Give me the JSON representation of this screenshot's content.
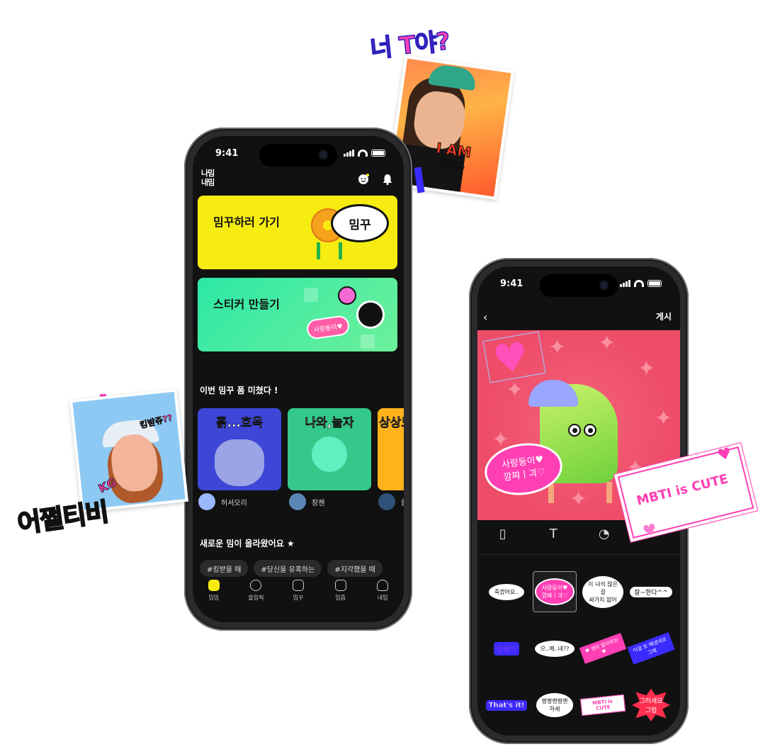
{
  "status_bar": {
    "time": "9:41"
  },
  "home": {
    "logo": "나밈\n내밈",
    "card_meme": {
      "title": "밈꾸하러 가기",
      "bubble": "밈꾸"
    },
    "card_sticker": {
      "title": "스티커 만들기",
      "pill": "사랑둥이♥"
    },
    "section_hot": "이번 밈꾸 폼 미쳤다 !",
    "thumbnails": [
      {
        "label": "흙...흐윽",
        "creator": "허서오리",
        "bg": "#3d46d6"
      },
      {
        "label": "나와,놀자",
        "creator": "장첸",
        "bg": "#34c98a"
      },
      {
        "label": "상상도",
        "creator": "들",
        "bg": "#ffb21c"
      }
    ],
    "section_new": "새로운 밈이 올라왔어요 ★",
    "chips": [
      "#킹받을 때",
      "#당신을 유혹하는",
      "#지각했을 때"
    ],
    "tabs": [
      "밈밈",
      "올밈픽",
      "밈꾸",
      "밈즘",
      "내밈"
    ]
  },
  "editor": {
    "post_label": "게시",
    "canvas_sticker": "사랑둥이♥\n깜쨔ㅣ긔♡",
    "stickers": [
      {
        "text": "죽겠어요..",
        "style": "st-white"
      },
      {
        "text": "사랑둥이♥\n깜쨔ㅣ긔♡",
        "style": "st-pink"
      },
      {
        "text": "이 녀석 많은 걸 \n싸가지 없어",
        "style": "st-white"
      },
      {
        "text": "잘~한다^^",
        "style": "st-plain"
      },
      {
        "text": "킹받아",
        "style": "st-purple"
      },
      {
        "text": "으..예..네??",
        "style": "st-white"
      },
      {
        "text": "♥ 생리 알아주는 ♥",
        "style": "st-tag"
      },
      {
        "text": "이걸 또 해냈네요 그래",
        "style": "st-tag2"
      },
      {
        "text": "That's it!",
        "style": "st-purple"
      },
      {
        "text": "짱짱맨짱맨\n하세",
        "style": "st-white"
      },
      {
        "text": "MBTI is CUTE",
        "style": "st-mbti"
      },
      {
        "text": "그러세요\n그럼",
        "style": "st-burst"
      }
    ]
  },
  "floating": {
    "title1": "너 T야?",
    "photo1_text": "I AM\n행복",
    "title2": "어쩔티비",
    "photo2_kg": "KG",
    "photo2_kb": "킹받쥬??",
    "mbti": "MBTI is CUTE"
  },
  "colors": {
    "yellow": "#f7ec12",
    "green": "#2de8a6",
    "pink": "#ff3fb4",
    "purple": "#3a2cff"
  }
}
